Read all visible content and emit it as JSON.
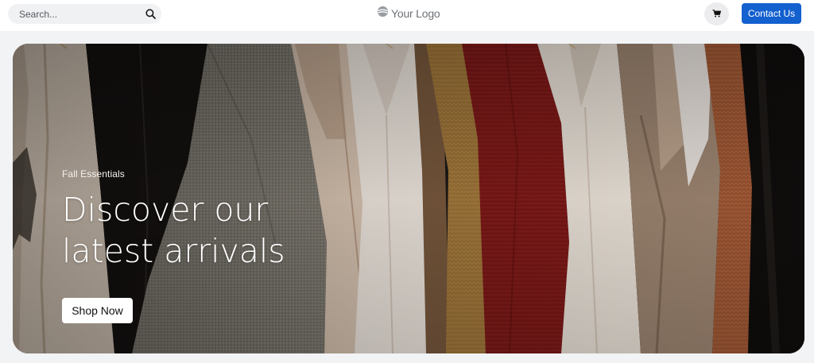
{
  "header": {
    "search": {
      "placeholder": "Search...",
      "icon": "search-icon"
    },
    "logo": {
      "text": "Your Logo",
      "icon": "logo-mark-icon"
    },
    "cart": {
      "icon": "cart-icon"
    },
    "contact_label": "Contact Us"
  },
  "hero": {
    "eyebrow": "Fall Essentials",
    "title_line1": "Discover our",
    "title_line2": "latest arrivals",
    "cta_label": "Shop Now",
    "image": "clothing-rack-photo"
  },
  "colors": {
    "accent": "#1360cf",
    "page_bg": "#f2f3f5",
    "header_bg": "#ffffff"
  }
}
